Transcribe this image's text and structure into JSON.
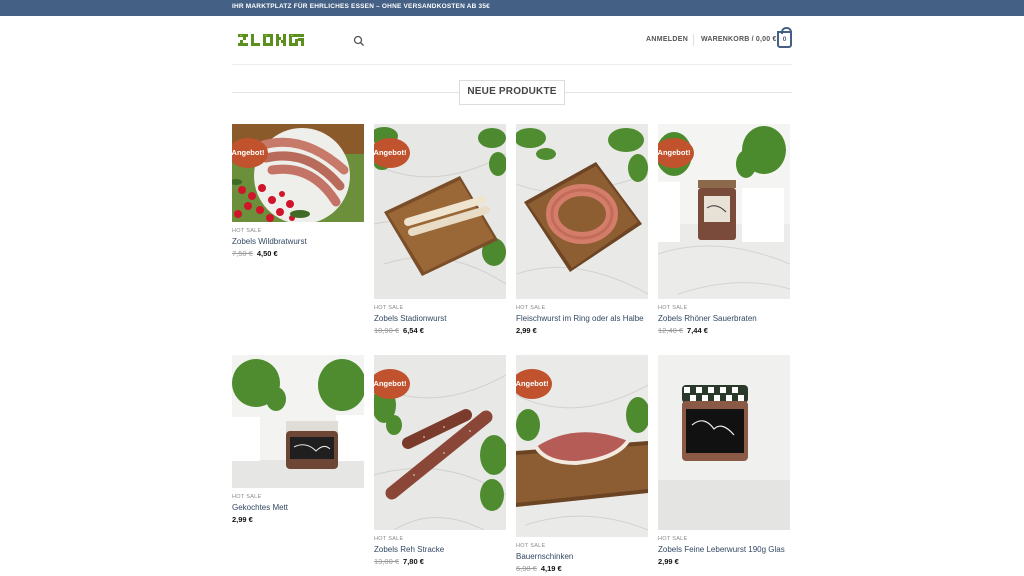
{
  "topbar": {
    "text": "IHR MARKTPLATZ FÜR EHRLICHES ESSEN – OHNE VERSANDKOSTEN AB 35€"
  },
  "header": {
    "logo_alt": "ZLONGS",
    "login_label": "ANMELDEN",
    "cart_label": "WARENKORB / 0,00 €",
    "cart_count": "0",
    "icons": {
      "search": "search-icon",
      "cart": "bag-icon"
    }
  },
  "section": {
    "title": "NEUE PRODUKTE"
  },
  "colors": {
    "topbar": "#446084",
    "badge": "#c0532d",
    "link": "#334862"
  },
  "products": [
    {
      "category": "HOT SALE",
      "name": "Zobels Wildbratwurst",
      "old_price": "7,50 €",
      "price": "4,50 €",
      "badge": "Angebot!"
    },
    {
      "category": "HOT SALE",
      "name": "Zobels Stadionwurst",
      "old_price": "10,90 €",
      "price": "6,54 €",
      "badge": "Angebot!"
    },
    {
      "category": "HOT SALE",
      "name": "Fleischwurst im Ring oder als Halbe",
      "old_price": "",
      "price": "2,99 €",
      "badge": ""
    },
    {
      "category": "HOT SALE",
      "name": "Zobels Rhöner Sauerbraten",
      "old_price": "12,40 €",
      "price": "7,44 €",
      "badge": "Angebot!"
    },
    {
      "category": "HOT SALE",
      "name": "Gekochtes Mett",
      "old_price": "",
      "price": "2,99 €",
      "badge": ""
    },
    {
      "category": "HOT SALE",
      "name": "Zobels Reh Stracke",
      "old_price": "13,00 €",
      "price": "7,80 €",
      "badge": "Angebot!"
    },
    {
      "category": "HOT SALE",
      "name": "Bauernschinken",
      "old_price": "6,98 €",
      "price": "4,19 €",
      "badge": "Angebot!"
    },
    {
      "category": "HOT SALE",
      "name": "Zobels Feine Leberwurst 190g Glas",
      "old_price": "",
      "price": "2,99 €",
      "badge": ""
    }
  ]
}
